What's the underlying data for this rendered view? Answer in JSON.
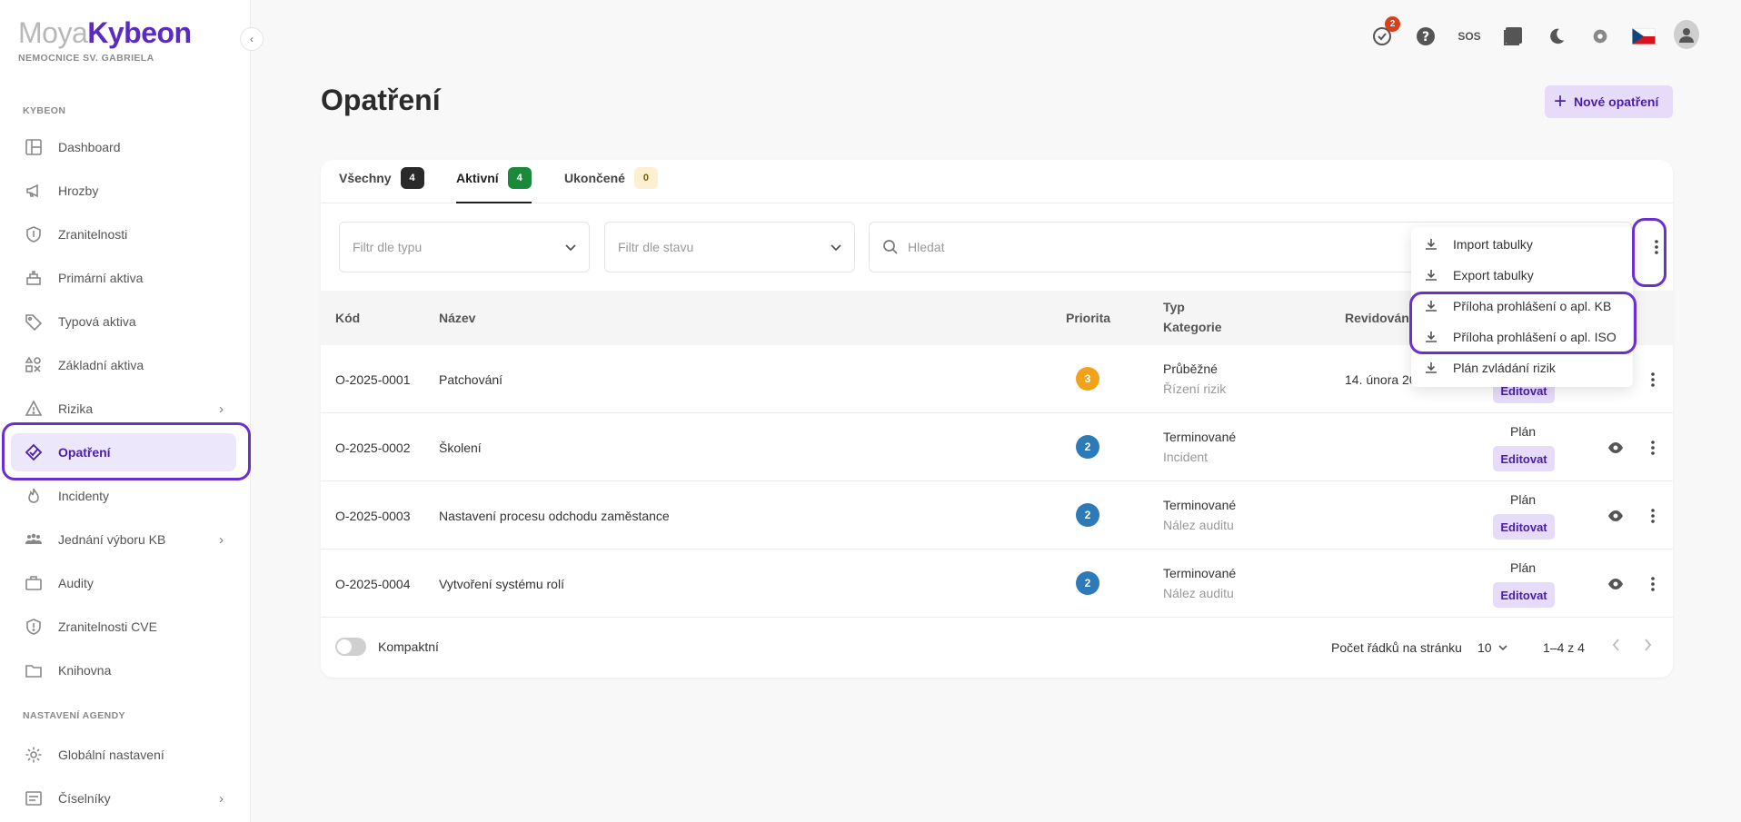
{
  "brand": {
    "logo_part1": "Moya",
    "logo_part2": "Kybeon",
    "org": "NEMOCNICE SV. GABRIELA"
  },
  "sidebar": {
    "section1": "KYBEON",
    "items": [
      {
        "label": "Dashboard",
        "icon": "dashboard-icon"
      },
      {
        "label": "Hrozby",
        "icon": "megaphone-icon"
      },
      {
        "label": "Zranitelnosti",
        "icon": "shield-icon"
      },
      {
        "label": "Primární aktiva",
        "icon": "layers-icon"
      },
      {
        "label": "Typová aktiva",
        "icon": "tag-icon"
      },
      {
        "label": "Základní aktiva",
        "icon": "shapes-icon"
      },
      {
        "label": "Rizika",
        "icon": "warning-icon",
        "expandable": true
      },
      {
        "label": "Opatření",
        "icon": "measures-icon",
        "active": true
      },
      {
        "label": "Incidenty",
        "icon": "fire-icon"
      },
      {
        "label": "Jednání výboru KB",
        "icon": "group-icon",
        "expandable": true
      },
      {
        "label": "Audity",
        "icon": "briefcase-icon"
      },
      {
        "label": "Zranitelnosti CVE",
        "icon": "shield-alert-icon"
      },
      {
        "label": "Knihovna",
        "icon": "folder-icon"
      }
    ],
    "section2": "NASTAVENÍ AGENDY",
    "items2": [
      {
        "label": "Globální nastavení",
        "icon": "gear-icon"
      },
      {
        "label": "Číselníky",
        "icon": "list-icon",
        "expandable": true
      }
    ]
  },
  "topbar": {
    "tasks_badge": "2",
    "sos_label": "SOS"
  },
  "page": {
    "title": "Opatření",
    "new_button": "Nové opatření"
  },
  "tabs": [
    {
      "label": "Všechny",
      "count": "4"
    },
    {
      "label": "Aktivní",
      "count": "4",
      "active": true
    },
    {
      "label": "Ukončené",
      "count": "0"
    }
  ],
  "filters": {
    "type_placeholder": "Filtr dle typu",
    "state_placeholder": "Filtr dle stavu",
    "search_placeholder": "Hledat"
  },
  "table": {
    "headers": {
      "code": "Kód",
      "name": "Název",
      "priority": "Priorita",
      "type": "Typ",
      "category": "Kategorie",
      "revised": "Revidováno"
    },
    "rows": [
      {
        "code": "O-2025-0001",
        "name": "Patchování",
        "priority": "3",
        "type": "Průběžné",
        "category": "Řízení rizik",
        "revised": "14. února 2025",
        "state": "",
        "edit": "Editovat"
      },
      {
        "code": "O-2025-0002",
        "name": "Školení",
        "priority": "2",
        "type": "Terminované",
        "category": "Incident",
        "revised": "",
        "state": "Plán",
        "edit": "Editovat"
      },
      {
        "code": "O-2025-0003",
        "name": "Nastavení procesu odchodu zaměstance",
        "priority": "2",
        "type": "Terminované",
        "category": "Nález auditu",
        "revised": "",
        "state": "Plán",
        "edit": "Editovat"
      },
      {
        "code": "O-2025-0004",
        "name": "Vytvoření systému rolí",
        "priority": "2",
        "type": "Terminované",
        "category": "Nález auditu",
        "revised": "",
        "state": "Plán",
        "edit": "Editovat"
      }
    ]
  },
  "footer": {
    "compact_label": "Kompaktní",
    "rows_per_page_label": "Počet řádků na stránku",
    "rows_per_page": "10",
    "range": "1–4 z 4"
  },
  "menu": {
    "items": [
      {
        "label": "Import tabulky"
      },
      {
        "label": "Export tabulky"
      },
      {
        "label": "Příloha prohlášení o apl. KB"
      },
      {
        "label": "Příloha prohlášení o apl. ISO"
      },
      {
        "label": "Plán zvládání rizik"
      }
    ]
  },
  "colors": {
    "accent": "#5a2bbf",
    "highlight": "#6a2fd3",
    "prio3": "#f0a21b",
    "prio2": "#2c7ab8",
    "active_bg": "#ede7fb"
  }
}
